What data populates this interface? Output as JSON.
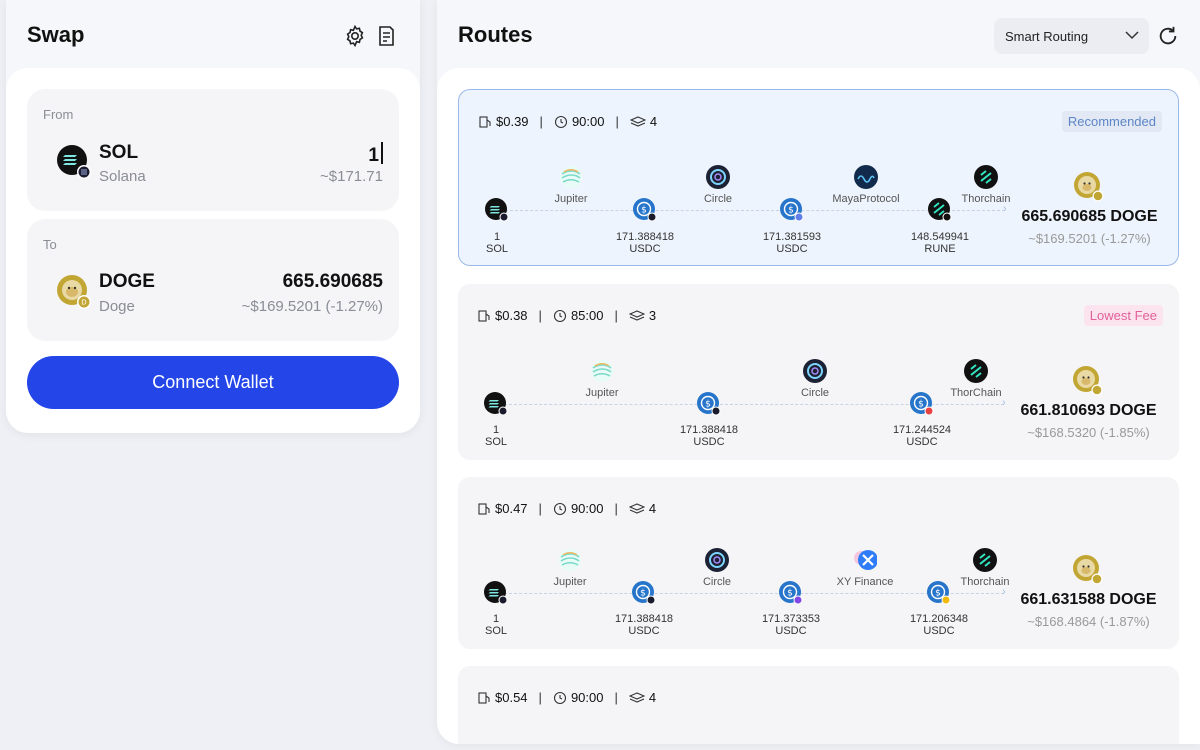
{
  "swap": {
    "title": "Swap",
    "from": {
      "label": "From",
      "symbol": "SOL",
      "name": "Solana",
      "amount": "1",
      "usd": "~$171.71"
    },
    "to": {
      "label": "To",
      "symbol": "DOGE",
      "name": "Doge",
      "amount": "665.690685",
      "usd": "~$169.5201 (-1.27%)"
    },
    "connect_label": "Connect Wallet"
  },
  "routes": {
    "title": "Routes",
    "routing_mode": "Smart Routing",
    "cards": [
      {
        "fee": "$0.39",
        "time": "90:00",
        "steps": "4",
        "badge": "Recommended",
        "nodes": [
          {
            "amount": "1",
            "symbol": "SOL"
          },
          {
            "amount": "171.388418",
            "symbol": "USDC"
          },
          {
            "amount": "171.381593",
            "symbol": "USDC"
          },
          {
            "amount": "148.549941",
            "symbol": "RUNE"
          }
        ],
        "providers": [
          "Jupiter",
          "Circle",
          "MayaProtocol",
          "Thorchain"
        ],
        "output": {
          "amount": "665.690685 DOGE",
          "usd": "~$169.5201  (-1.27%)"
        }
      },
      {
        "fee": "$0.38",
        "time": "85:00",
        "steps": "3",
        "badge": "Lowest Fee",
        "nodes": [
          {
            "amount": "1",
            "symbol": "SOL"
          },
          {
            "amount": "171.388418",
            "symbol": "USDC"
          },
          {
            "amount": "171.244524",
            "symbol": "USDC"
          }
        ],
        "providers": [
          "Jupiter",
          "Circle",
          "ThorChain"
        ],
        "output": {
          "amount": "661.810693 DOGE",
          "usd": "~$168.5320  (-1.85%)"
        }
      },
      {
        "fee": "$0.47",
        "time": "90:00",
        "steps": "4",
        "badge": "",
        "nodes": [
          {
            "amount": "1",
            "symbol": "SOL"
          },
          {
            "amount": "171.388418",
            "symbol": "USDC"
          },
          {
            "amount": "171.373353",
            "symbol": "USDC"
          },
          {
            "amount": "171.206348",
            "symbol": "USDC"
          }
        ],
        "providers": [
          "Jupiter",
          "Circle",
          "XY Finance",
          "Thorchain"
        ],
        "output": {
          "amount": "661.631588 DOGE",
          "usd": "~$168.4864  (-1.87%)"
        }
      },
      {
        "fee": "$0.54",
        "time": "90:00",
        "steps": "4",
        "badge": ""
      }
    ]
  },
  "colors": {
    "accent": "#2446e8",
    "recommended": "#5d86c7",
    "lowest_fee": "#e0609a",
    "usdc": "#2775ca",
    "doge": "#c2a633"
  },
  "icons": [
    "settings-icon",
    "history-icon",
    "swap-arrows-icon",
    "chevron-down-icon",
    "refresh-icon",
    "gas-icon",
    "clock-icon",
    "layers-icon"
  ]
}
